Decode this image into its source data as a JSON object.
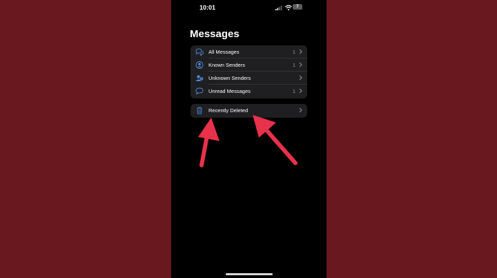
{
  "status_bar": {
    "time": "10:01",
    "battery": "7"
  },
  "page": {
    "title": "Messages"
  },
  "filters": [
    {
      "label": "All Messages",
      "count": "1",
      "icon": "chat-bubbles-icon"
    },
    {
      "label": "Known Senders",
      "count": "1",
      "icon": "person-circle-icon"
    },
    {
      "label": "Unknown Senders",
      "count": "",
      "icon": "person-question-icon"
    },
    {
      "label": "Unread Messages",
      "count": "1",
      "icon": "chat-bubble-icon"
    }
  ],
  "recently_deleted": {
    "label": "Recently Deleted",
    "icon": "trash-icon"
  },
  "colors": {
    "background": "#6a1820",
    "screen": "#000000",
    "row_background": "#1f1f21",
    "accent_blue": "#4f8bdf",
    "arrow_red": "#e8314a"
  }
}
